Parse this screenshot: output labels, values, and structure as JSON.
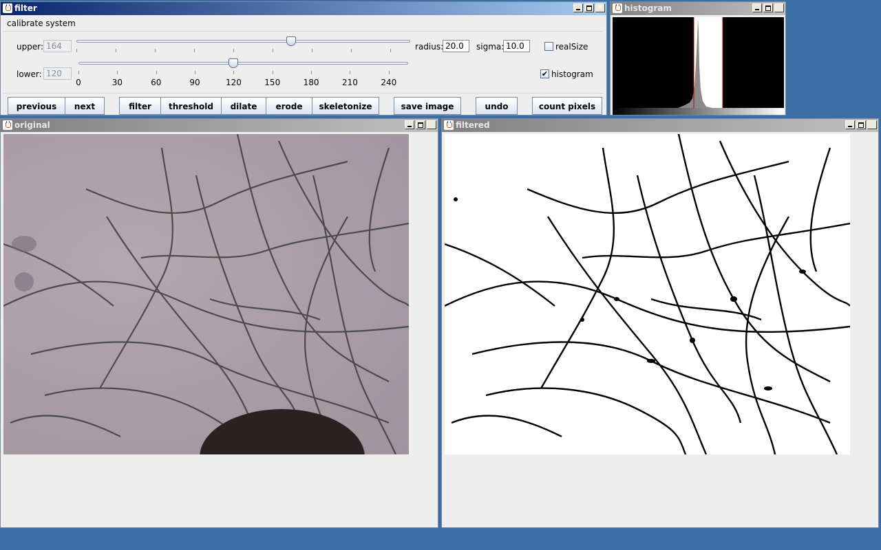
{
  "filter_window": {
    "title": "filter",
    "section_label": "calibrate system",
    "upper_label": "upper:",
    "upper_value": "164",
    "lower_label": "lower:",
    "lower_value": "120",
    "radius_label": "radius:",
    "radius_value": "20.0",
    "sigma_label": "sigma:",
    "sigma_value": "10.0",
    "realsize_label": "realSize",
    "realsize_checked": false,
    "histogram_label": "histogram",
    "histogram_checked": true,
    "histogram_check_glyph": "✔",
    "slider_min": 0,
    "slider_max": 255,
    "upper_slider_value": 164,
    "lower_slider_value": 120,
    "tick_labels": [
      "0",
      "30",
      "60",
      "90",
      "120",
      "150",
      "180",
      "210",
      "240"
    ],
    "buttons": {
      "previous": "previous",
      "next": "next",
      "filter": "filter",
      "threshold": "threshold",
      "dilate": "dilate",
      "erode": "erode",
      "skeletonize": "skeletonize",
      "save_image": "save image",
      "undo": "undo",
      "count_pixels": "count pixels"
    }
  },
  "histogram_window": {
    "title": "histogram"
  },
  "original_window": {
    "title": "original"
  },
  "filtered_window": {
    "title": "filtered"
  },
  "window_controls": {
    "close_glyph": "✕"
  },
  "colors": {
    "desktop": "#3a6ea5",
    "title_active": "#0a246a",
    "title_inactive": "#808080",
    "threshold_line": "#c00000",
    "original_bg": "#a89aa4"
  }
}
